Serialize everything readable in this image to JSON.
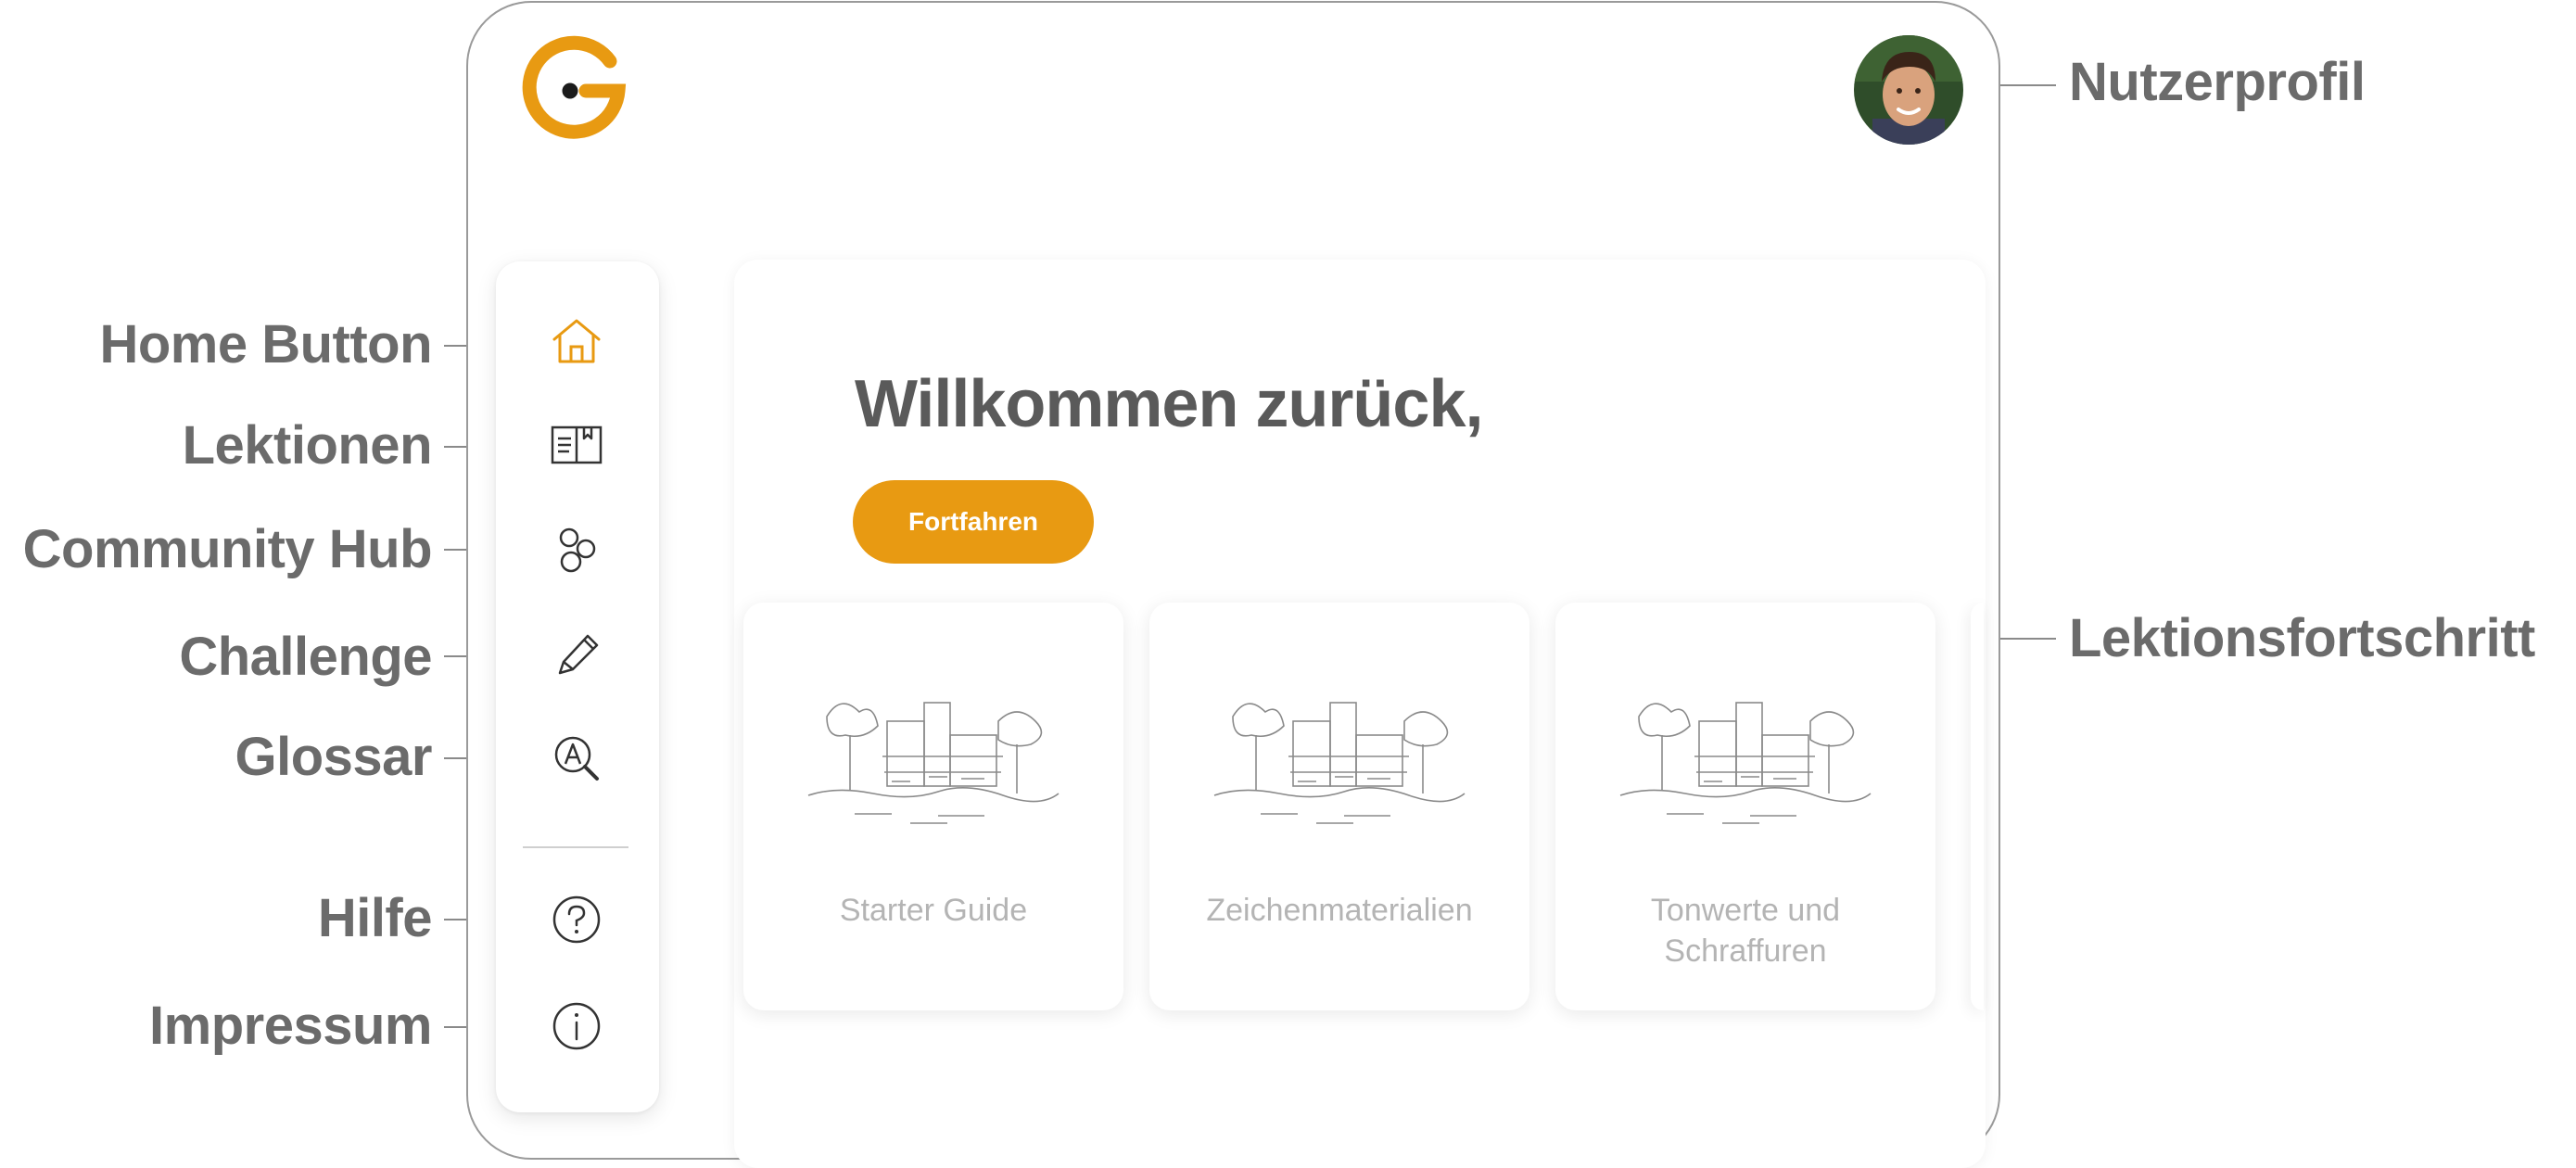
{
  "app": {
    "logo_letter": "G",
    "accent_color": "#E89A12"
  },
  "callouts": {
    "home": "Home Button",
    "lessons": "Lektionen",
    "community": "Community Hub",
    "challenge": "Challenge",
    "glossary": "Glossar",
    "help": "Hilfe",
    "imprint": "Impressum",
    "profile": "Nutzerprofil",
    "progress": "Lektionsfortschritt"
  },
  "sidebar": {
    "items": [
      {
        "id": "home",
        "icon": "home-icon",
        "active": true
      },
      {
        "id": "lessons",
        "icon": "book-icon"
      },
      {
        "id": "community",
        "icon": "community-icon"
      },
      {
        "id": "challenge",
        "icon": "pencil-icon"
      },
      {
        "id": "glossary",
        "icon": "glossary-search-icon"
      },
      {
        "id": "help",
        "icon": "help-icon"
      },
      {
        "id": "imprint",
        "icon": "info-icon"
      }
    ]
  },
  "header": {
    "avatar": "user-avatar"
  },
  "main": {
    "welcome": "Willkommen zurück,",
    "continue_label": "Fortfahren",
    "lessons": [
      {
        "title": "Starter Guide"
      },
      {
        "title": "Zeichenmaterialien"
      },
      {
        "title": "Tonwerte und Schraffuren"
      }
    ]
  }
}
